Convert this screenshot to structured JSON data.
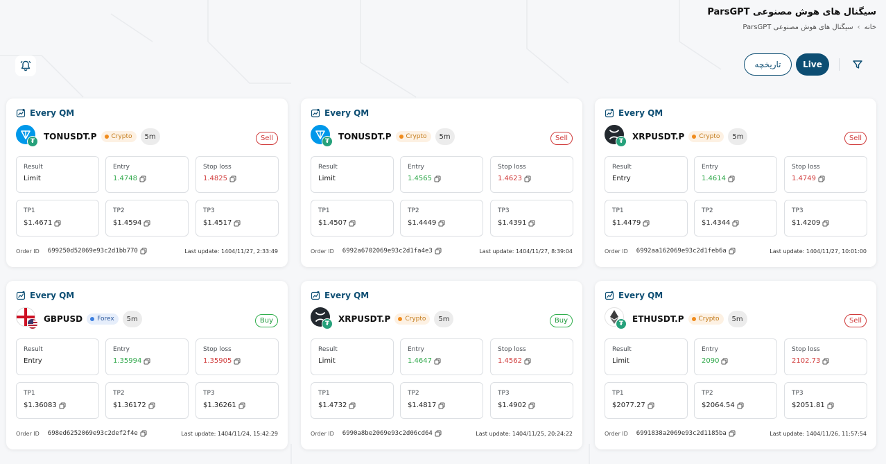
{
  "page": {
    "title": "سیگنال های هوش مصنوعی ParsGPT",
    "breadcrumb": [
      "خانه",
      "سیگنال های هوش مصنوعی ParsGPT"
    ]
  },
  "toolbar": {
    "live_label": "Live",
    "history_label": "تاریخچه",
    "filter_icon": "filter-icon",
    "bell_icon": "bell-icon"
  },
  "labels": {
    "result": "Result",
    "entry": "Entry",
    "stop_loss": "Stop loss",
    "tp1": "TP1",
    "tp2": "TP2",
    "tp3": "TP3",
    "order_id": "Order ID",
    "last_update_prefix": "Last update: "
  },
  "colors": {
    "brand": "#0d4e73",
    "green": "#2fa84a",
    "red": "#d03a3a",
    "crypto_badge": "#f08b1c",
    "forex_badge": "#3c7fe0"
  },
  "signals": [
    {
      "strategy": "Every QM",
      "symbol": "TONUSDT.P",
      "coin": "ton",
      "market": "Crypto",
      "timeframe": "5m",
      "side": "Sell",
      "result": "Limit",
      "entry": "1.4748",
      "stop_loss": "1.4825",
      "tp1": "$1.4671",
      "tp2": "$1.4594",
      "tp3": "$1.4517",
      "order_id": "699250d52069e93c2d1bb770",
      "last_update": "Last update: 1404/11/27, 2:33:49"
    },
    {
      "strategy": "Every QM",
      "symbol": "TONUSDT.P",
      "coin": "ton",
      "market": "Crypto",
      "timeframe": "5m",
      "side": "Sell",
      "result": "Limit",
      "entry": "1.4565",
      "stop_loss": "1.4623",
      "tp1": "$1.4507",
      "tp2": "$1.4449",
      "tp3": "$1.4391",
      "order_id": "6992a6702069e93c2d1fa4e3",
      "last_update": "Last update: 1404/11/27, 8:39:04"
    },
    {
      "strategy": "Every QM",
      "symbol": "XRPUSDT.P",
      "coin": "xrp",
      "market": "Crypto",
      "timeframe": "5m",
      "side": "Sell",
      "result": "Entry",
      "entry": "1.4614",
      "stop_loss": "1.4749",
      "tp1": "$1.4479",
      "tp2": "$1.4344",
      "tp3": "$1.4209",
      "order_id": "6992aa162069e93c2d1feb6a",
      "last_update": "Last update: 1404/11/27, 10:01:00"
    },
    {
      "strategy": "Every QM",
      "symbol": "GBPUSD",
      "coin": "gbpusd",
      "market": "Forex",
      "timeframe": "5m",
      "side": "Buy",
      "result": "Entry",
      "entry": "1.35994",
      "stop_loss": "1.35905",
      "tp1": "$1.36083",
      "tp2": "$1.36172",
      "tp3": "$1.36261",
      "order_id": "698ed6252069e93c2def2f4e",
      "last_update": "Last update: 1404/11/24, 15:42:29"
    },
    {
      "strategy": "Every QM",
      "symbol": "XRPUSDT.P",
      "coin": "xrp",
      "market": "Crypto",
      "timeframe": "5m",
      "side": "Buy",
      "result": "Limit",
      "entry": "1.4647",
      "stop_loss": "1.4562",
      "tp1": "$1.4732",
      "tp2": "$1.4817",
      "tp3": "$1.4902",
      "order_id": "6990a8be2069e93c2d06cd64",
      "last_update": "Last update: 1404/11/25, 20:24:22"
    },
    {
      "strategy": "Every QM",
      "symbol": "ETHUSDT.P",
      "coin": "eth",
      "market": "Crypto",
      "timeframe": "5m",
      "side": "Sell",
      "result": "Limit",
      "entry": "2090",
      "stop_loss": "2102.73",
      "tp1": "$2077.27",
      "tp2": "$2064.54",
      "tp3": "$2051.81",
      "order_id": "6991838a2069e93c2d1185ba",
      "last_update": "Last update: 1404/11/26, 11:57:54"
    }
  ]
}
